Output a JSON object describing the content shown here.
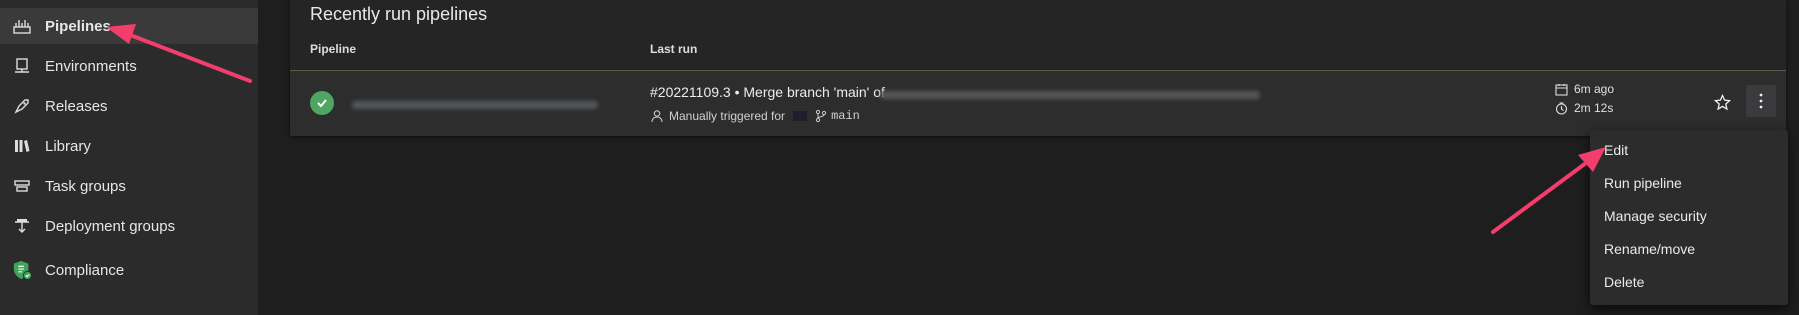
{
  "sidebar": {
    "items": [
      {
        "label": "Pipelines",
        "icon": "pipelines-icon",
        "active": true
      },
      {
        "label": "Environments",
        "icon": "environments-icon",
        "active": false
      },
      {
        "label": "Releases",
        "icon": "releases-icon",
        "active": false
      },
      {
        "label": "Library",
        "icon": "library-icon",
        "active": false
      },
      {
        "label": "Task groups",
        "icon": "task-groups-icon",
        "active": false
      },
      {
        "label": "Deployment groups",
        "icon": "deployment-groups-icon",
        "active": false
      },
      {
        "label": "Compliance",
        "icon": "compliance-icon",
        "active": false
      }
    ]
  },
  "main": {
    "section_title": "Recently run pipelines",
    "columns": {
      "pipeline": "Pipeline",
      "last_run": "Last run"
    },
    "rows": [
      {
        "status": "succeeded",
        "run_title": "#20221109.3 • Merge branch 'main' of",
        "trigger": "Manually triggered for",
        "branch": "main",
        "ago": "6m ago",
        "duration": "2m 12s"
      }
    ]
  },
  "context_menu": {
    "items": [
      "Edit",
      "Run pipeline",
      "Manage security",
      "Rename/move",
      "Delete"
    ]
  },
  "colors": {
    "accent_arrow": "#f23d6d",
    "success": "#4fa562",
    "sidebar_bg": "#2b2b2b",
    "page_bg": "#1e1e1e"
  }
}
